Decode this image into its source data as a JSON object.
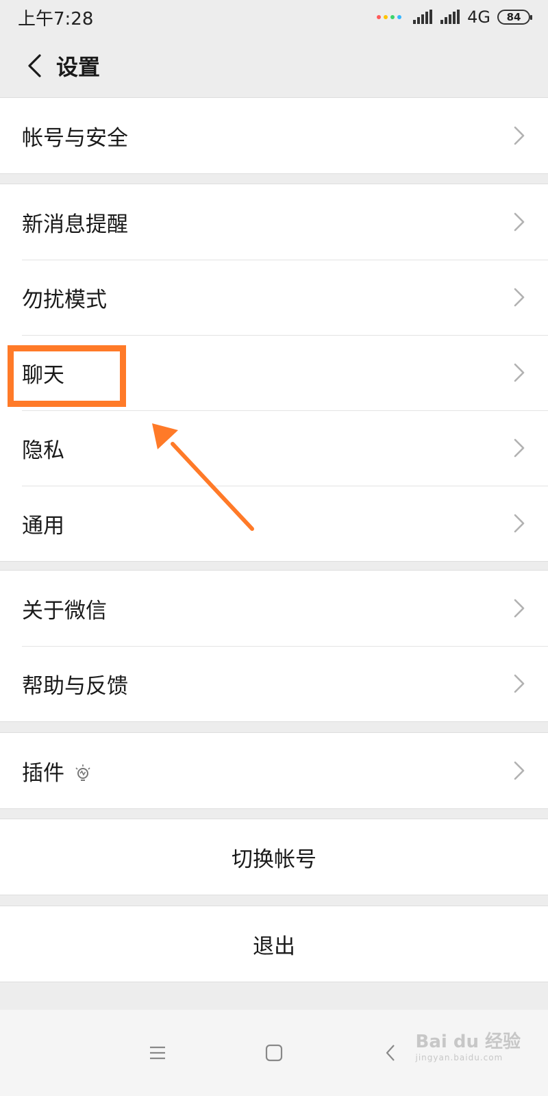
{
  "status_bar": {
    "time": "上午7:28",
    "network": "4G",
    "battery": "84",
    "dot_colors": [
      "#ff5a5a",
      "#ffc400",
      "#3cd46b",
      "#38b6ff"
    ]
  },
  "header": {
    "title": "设置",
    "back_icon": "chevron-left-icon"
  },
  "groups": [
    {
      "items": [
        {
          "label": "帐号与安全"
        }
      ]
    },
    {
      "items": [
        {
          "label": "新消息提醒"
        },
        {
          "label": "勿扰模式"
        },
        {
          "label": "聊天"
        },
        {
          "label": "隐私"
        },
        {
          "label": "通用"
        }
      ]
    },
    {
      "items": [
        {
          "label": "关于微信"
        },
        {
          "label": "帮助与反馈"
        }
      ]
    },
    {
      "items": [
        {
          "label": "插件",
          "icon": "lightbulb-icon"
        }
      ]
    }
  ],
  "actions": {
    "switch_account": "切换帐号",
    "logout": "退出"
  },
  "annotation": {
    "highlight_target": "聊天",
    "color": "#ff7a28"
  },
  "bottom_nav": {
    "icons": [
      "menu-icon",
      "home-icon",
      "back-icon"
    ]
  },
  "watermark": {
    "brand": "Bai du 经验",
    "url": "jingyan.baidu.com"
  }
}
